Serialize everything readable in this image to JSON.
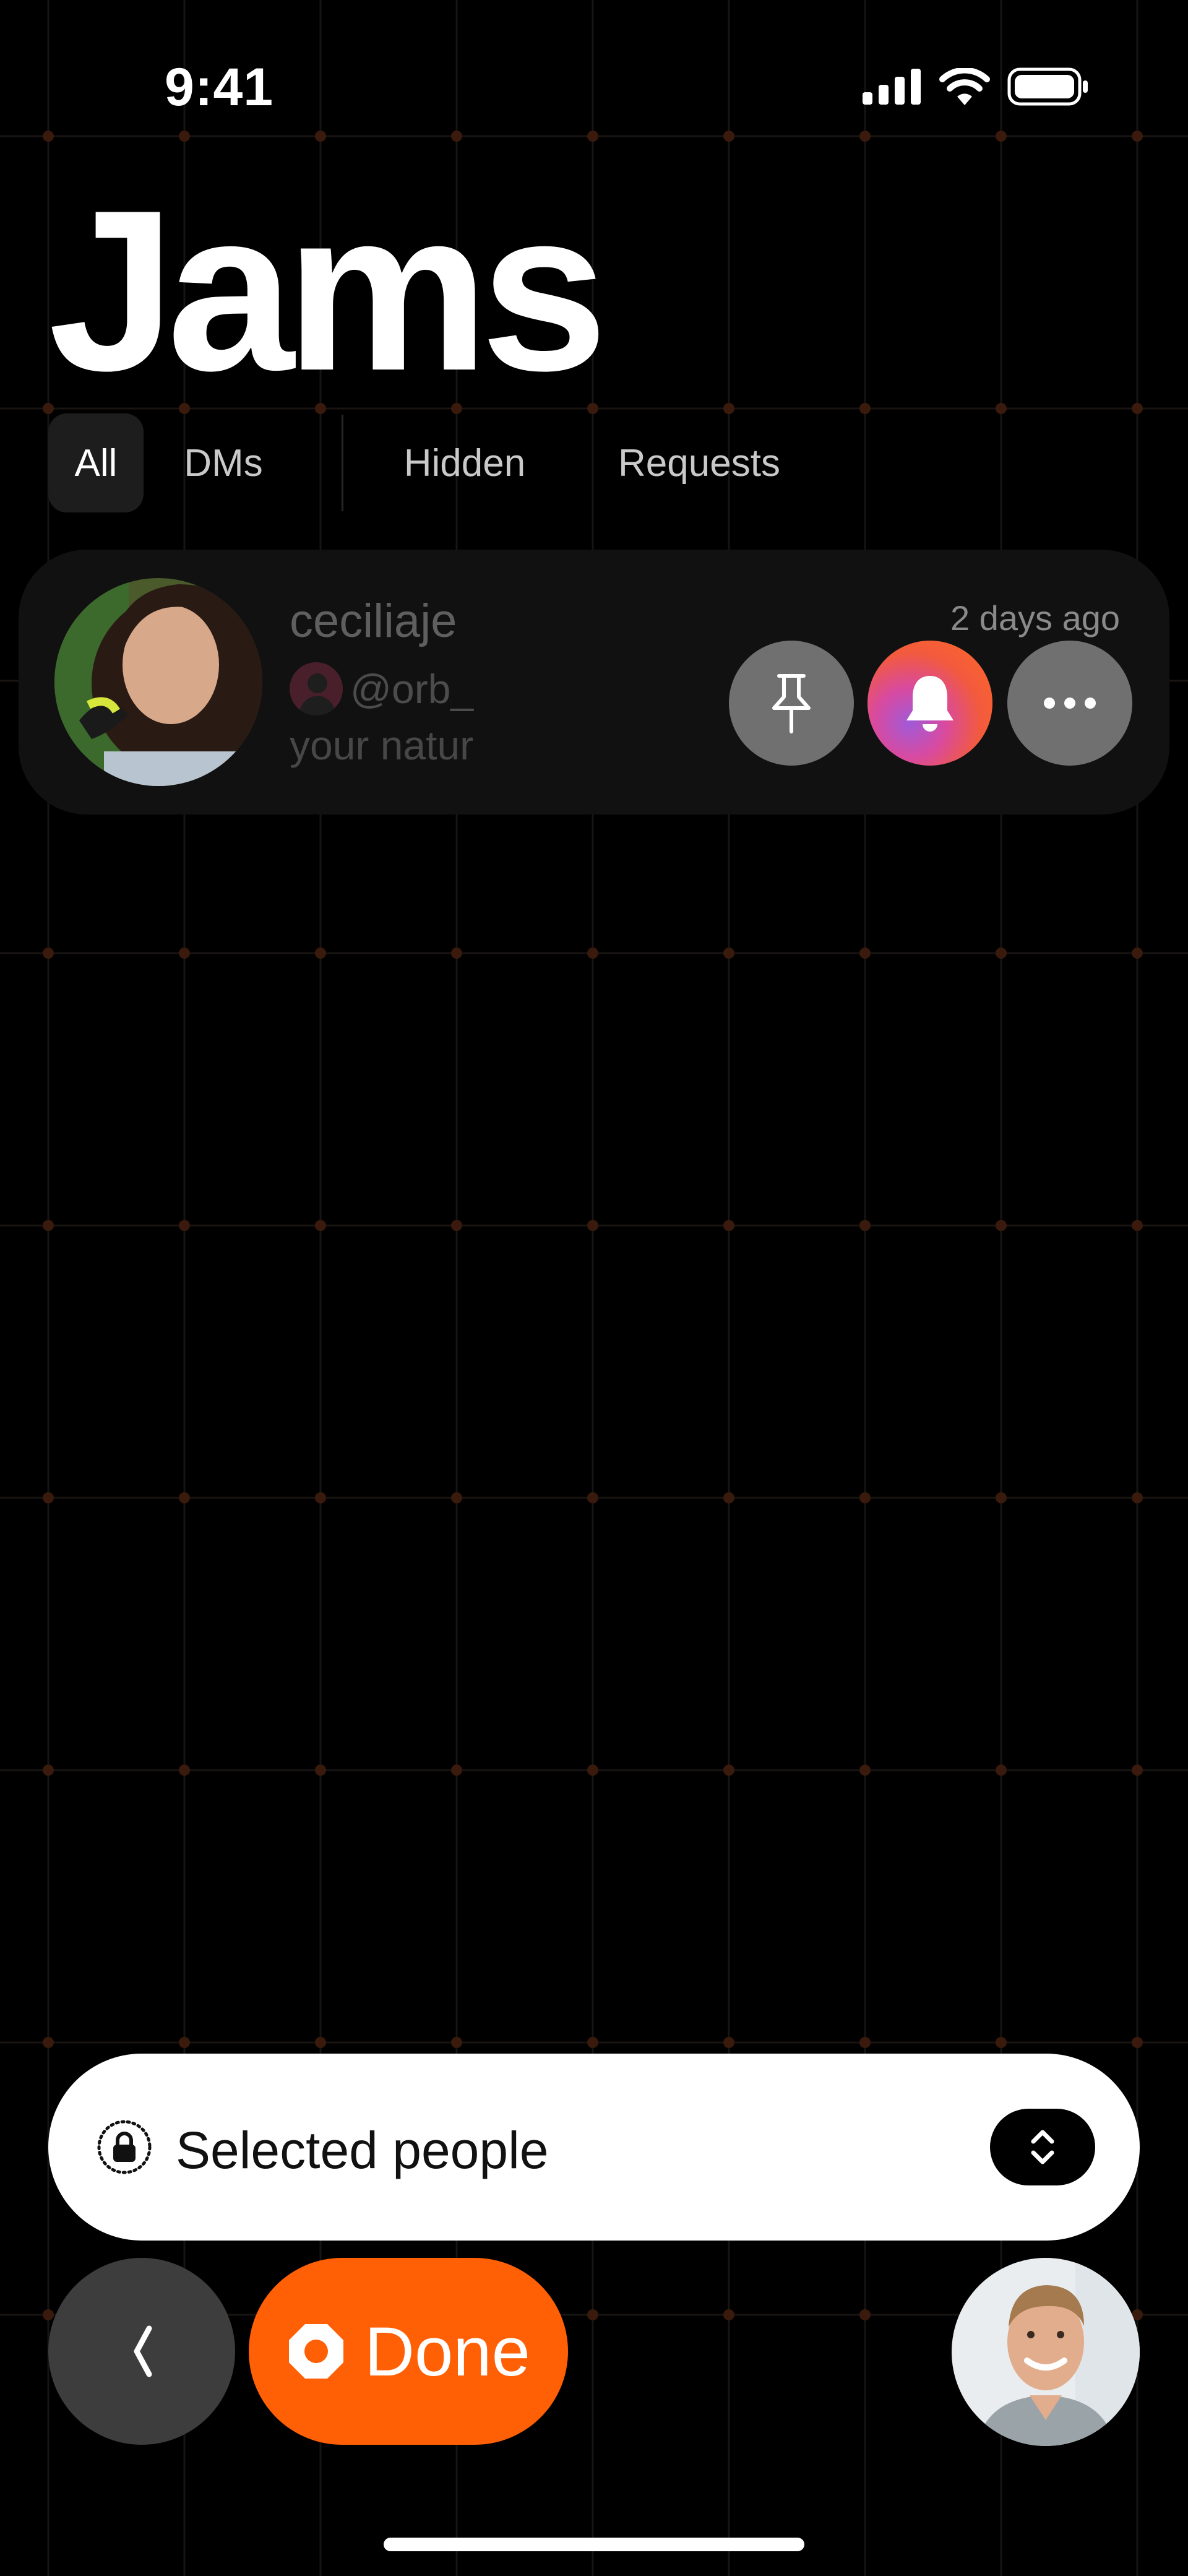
{
  "status_bar": {
    "time": "9:41"
  },
  "header": {
    "title": "Jams"
  },
  "tabs": [
    {
      "label": "All",
      "selected": true
    },
    {
      "label": "DMs",
      "selected": false
    },
    {
      "label": "Hidden",
      "selected": false
    },
    {
      "label": "Requests",
      "selected": false
    }
  ],
  "conversation": {
    "name": "ceciliaje",
    "handle": "@orb_",
    "preview": "your natur",
    "time_ago": "2 days ago",
    "actions": [
      "pin-icon",
      "bell-icon",
      "more-icon"
    ]
  },
  "audience": {
    "label": "Selected people"
  },
  "bottom_bar": {
    "done_label": "Done"
  },
  "colors": {
    "background": "#000000",
    "accent_orange": "#ff6006",
    "row_background": "#111111",
    "action_gray": "#707070"
  }
}
